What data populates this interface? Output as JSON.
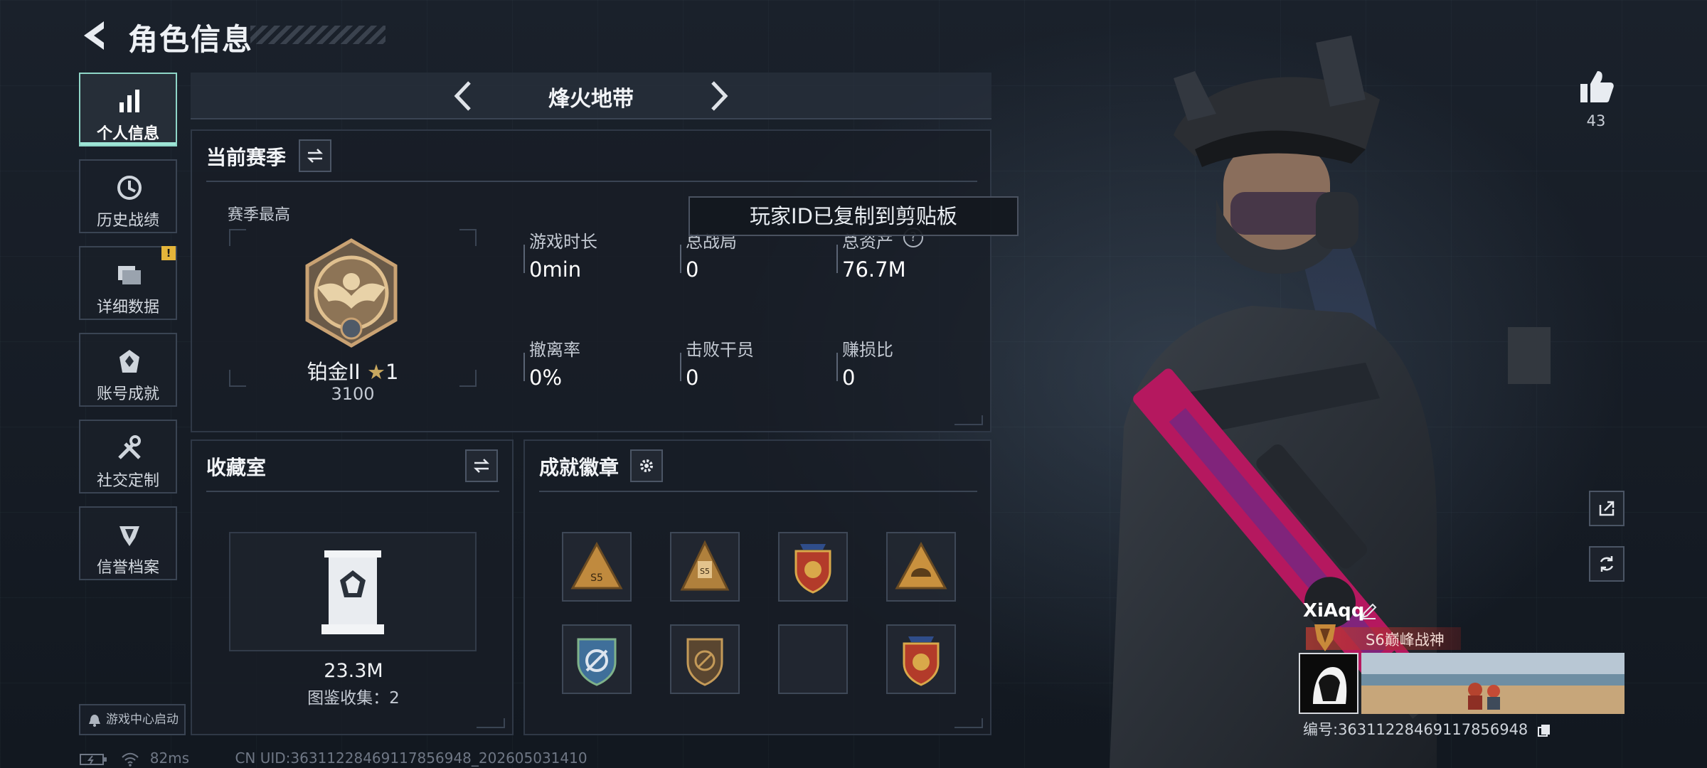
{
  "header": {
    "title": "角色信息"
  },
  "sidebar": {
    "items": [
      {
        "label": "个人信息",
        "icon": "bar-chart-icon",
        "active": true
      },
      {
        "label": "历史战绩",
        "icon": "clock-icon"
      },
      {
        "label": "详细数据",
        "icon": "folder-icon",
        "alert": "!"
      },
      {
        "label": "账号成就",
        "icon": "achievement-icon"
      },
      {
        "label": "社交定制",
        "icon": "tools-icon"
      },
      {
        "label": "信誉档案",
        "icon": "reputation-icon"
      }
    ],
    "launch_label": "游戏中心启动"
  },
  "mode": {
    "title": "烽火地带"
  },
  "season": {
    "title": "当前赛季",
    "best_label": "赛季最高",
    "rank_name": "铂金II",
    "rank_stars": "1",
    "rank_points": "3100",
    "stats": [
      {
        "label": "游戏时长",
        "value": "0min"
      },
      {
        "label": "总战局",
        "value": "0"
      },
      {
        "label": "总资产",
        "value": "76.7M"
      },
      {
        "label": "撤离率",
        "value": "0%"
      },
      {
        "label": "击败干员",
        "value": "0"
      },
      {
        "label": "赚损比",
        "value": "0"
      }
    ]
  },
  "toast": {
    "text": "玩家ID已复制到剪贴板"
  },
  "collection": {
    "title": "收藏室",
    "value": "23.3M",
    "count_text": "图鉴收集：2"
  },
  "badges": {
    "title": "成就徽章",
    "items": [
      {
        "icon": "badge-s5-triangle-icon",
        "text": "S5"
      },
      {
        "icon": "badge-s5-pyramid-icon",
        "text": "S5"
      },
      {
        "icon": "badge-star-shield-icon"
      },
      {
        "icon": "badge-helmet-triangle-icon"
      },
      {
        "icon": "badge-blue-shield-icon"
      },
      {
        "icon": "badge-bronze-shield-icon"
      },
      {
        "icon": "empty-slot"
      },
      {
        "icon": "badge-red-shield-icon"
      }
    ]
  },
  "profile": {
    "like_count": "43",
    "name": "XiAqq",
    "title": "S6巅峰战神",
    "uid_line": "编号:3631122846911785694​8"
  },
  "status_bar": {
    "ping": "82ms",
    "cn_uid": "CN UID:36311228469117856948_202605031410"
  },
  "colors": {
    "accent": "#9ee5d6",
    "panel_border": "#2f3846",
    "alert": "#e5b53a",
    "title_banner": "#be3c32"
  }
}
